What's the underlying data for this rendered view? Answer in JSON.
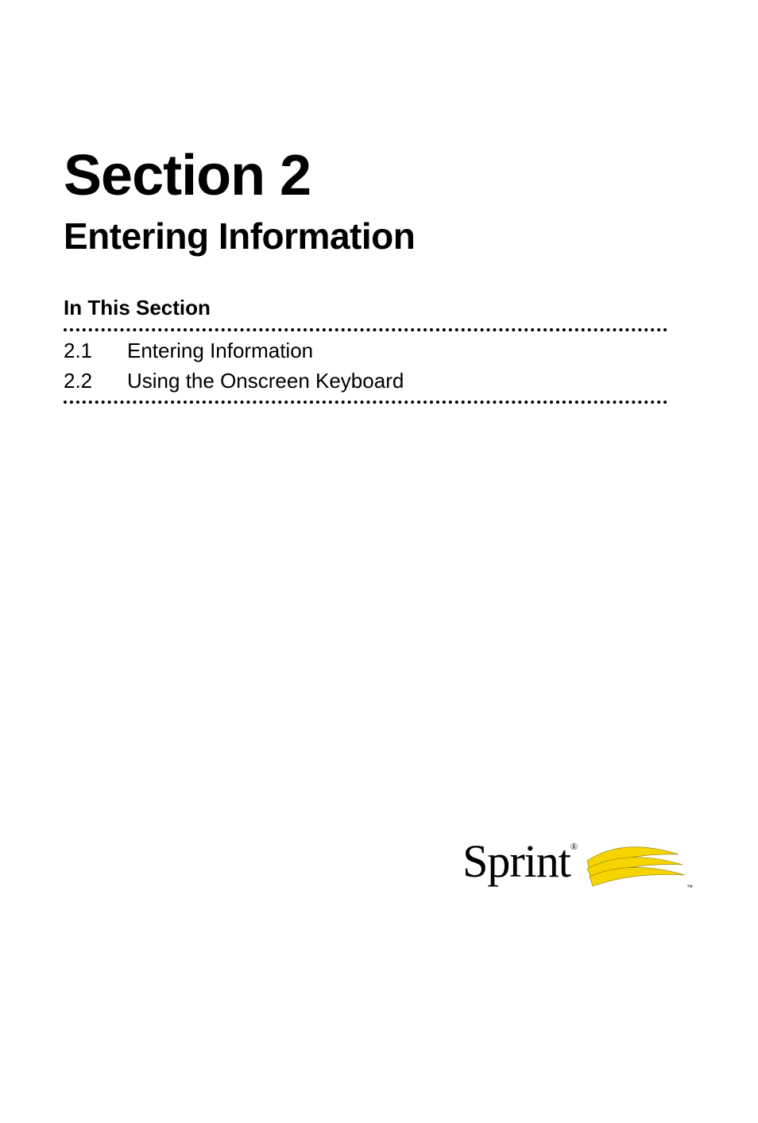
{
  "section": {
    "number_label": "Section 2",
    "title": "Entering Information"
  },
  "in_this_section_label": "In This Section",
  "toc": [
    {
      "num": "2.1",
      "label": "Entering Information"
    },
    {
      "num": "2.2",
      "label": "Using the Onscreen Keyboard"
    }
  ],
  "brand": {
    "name": "Sprint",
    "registered": "®",
    "tm": "™"
  }
}
